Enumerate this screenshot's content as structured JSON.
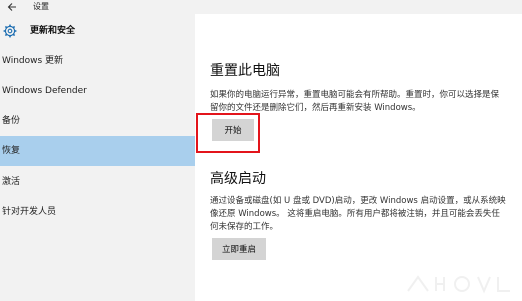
{
  "window": {
    "title": "设置"
  },
  "sidebar": {
    "section_title": "更新和安全",
    "items": [
      {
        "label": "Windows 更新",
        "active": false
      },
      {
        "label": "Windows Defender",
        "active": false
      },
      {
        "label": "备份",
        "active": false
      },
      {
        "label": "恢复",
        "active": true
      },
      {
        "label": "激活",
        "active": false
      },
      {
        "label": "针对开发人员",
        "active": false
      }
    ]
  },
  "reset": {
    "heading": "重置此电脑",
    "description": "如果你的电脑运行异常，重置电脑可能会有所帮助。重置时，你可以选择是保留你的文件还是删除它们，然后再重新安装 Windows。",
    "button_label": "开始"
  },
  "advanced": {
    "heading": "高级启动",
    "description": "通过设备或磁盘(如 U 盘或 DVD)启动，更改 Windows 启动设置，或从系统映像还原 Windows。 这将重启电脑。所有用户都将被注销，并且可能会丢失任何未保存的工作。",
    "button_label": "立即重启"
  },
  "icons": {
    "back": "back-arrow-icon",
    "settings": "gear-icon"
  },
  "colors": {
    "active_item": "#a9cfed",
    "highlight_box": "#e3141b",
    "sidebar_bg": "#f2f2f2",
    "button_bg": "#d4d4d4"
  }
}
